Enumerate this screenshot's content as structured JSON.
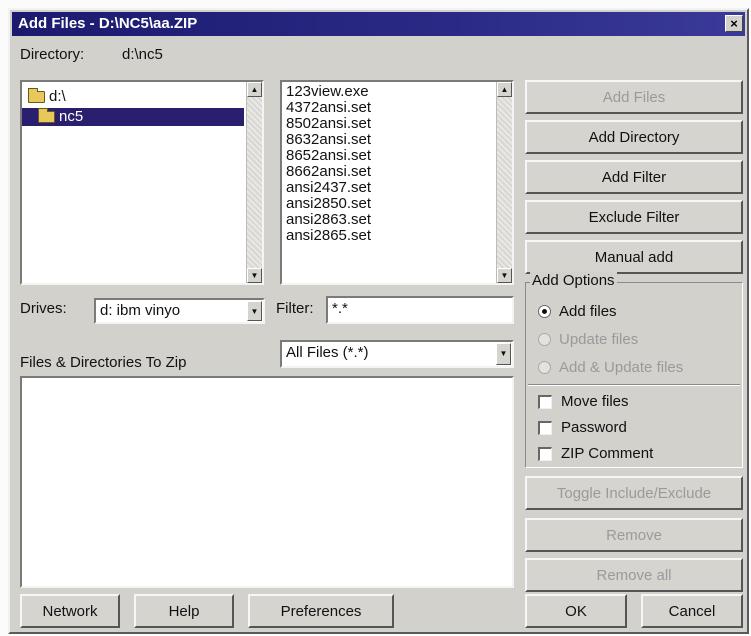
{
  "window": {
    "title": "Add Files - D:\\NC5\\aa.ZIP",
    "close": "×"
  },
  "directory": {
    "label": "Directory:",
    "value": "d:\\nc5"
  },
  "folders": [
    {
      "label": "d:\\"
    },
    {
      "label": "nc5"
    }
  ],
  "files": [
    "123view.exe",
    "4372ansi.set",
    "8502ansi.set",
    "8632ansi.set",
    "8652ansi.set",
    "8662ansi.set",
    "ansi2437.set",
    "ansi2850.set",
    "ansi2863.set",
    "ansi2865.set"
  ],
  "drives": {
    "label": "Drives:",
    "value": "d: ibm vinyo"
  },
  "filter": {
    "label": "Filter:",
    "value": "*.*"
  },
  "file_type": {
    "value": "All Files (*.*)"
  },
  "zip_list": {
    "label": "Files & Directories To Zip"
  },
  "buttons": {
    "add_files": "Add Files",
    "add_directory": "Add Directory",
    "add_filter": "Add Filter",
    "exclude_filter": "Exclude Filter",
    "manual_add": "Manual add",
    "toggle": "Toggle Include/Exclude",
    "remove": "Remove",
    "remove_all": "Remove all",
    "network": "Network",
    "help": "Help",
    "preferences": "Preferences",
    "ok": "OK",
    "cancel": "Cancel"
  },
  "add_options": {
    "label": "Add Options",
    "radios": [
      {
        "label": "Add files",
        "checked": true,
        "enabled": true
      },
      {
        "label": "Update files",
        "checked": false,
        "enabled": false
      },
      {
        "label": "Add & Update files",
        "checked": false,
        "enabled": false
      }
    ],
    "checks": [
      {
        "label": "Move files",
        "checked": false
      },
      {
        "label": "Password",
        "checked": false
      },
      {
        "label": "ZIP Comment",
        "checked": false
      }
    ]
  },
  "icons": {
    "folder": "folder-icon",
    "scroll_up": "▲",
    "scroll_down": "▼",
    "dropdown": "▼"
  },
  "colors": {
    "titlebar": "#1c1a6e",
    "selection": "#2a1f6e",
    "face": "#d3d1cc"
  }
}
